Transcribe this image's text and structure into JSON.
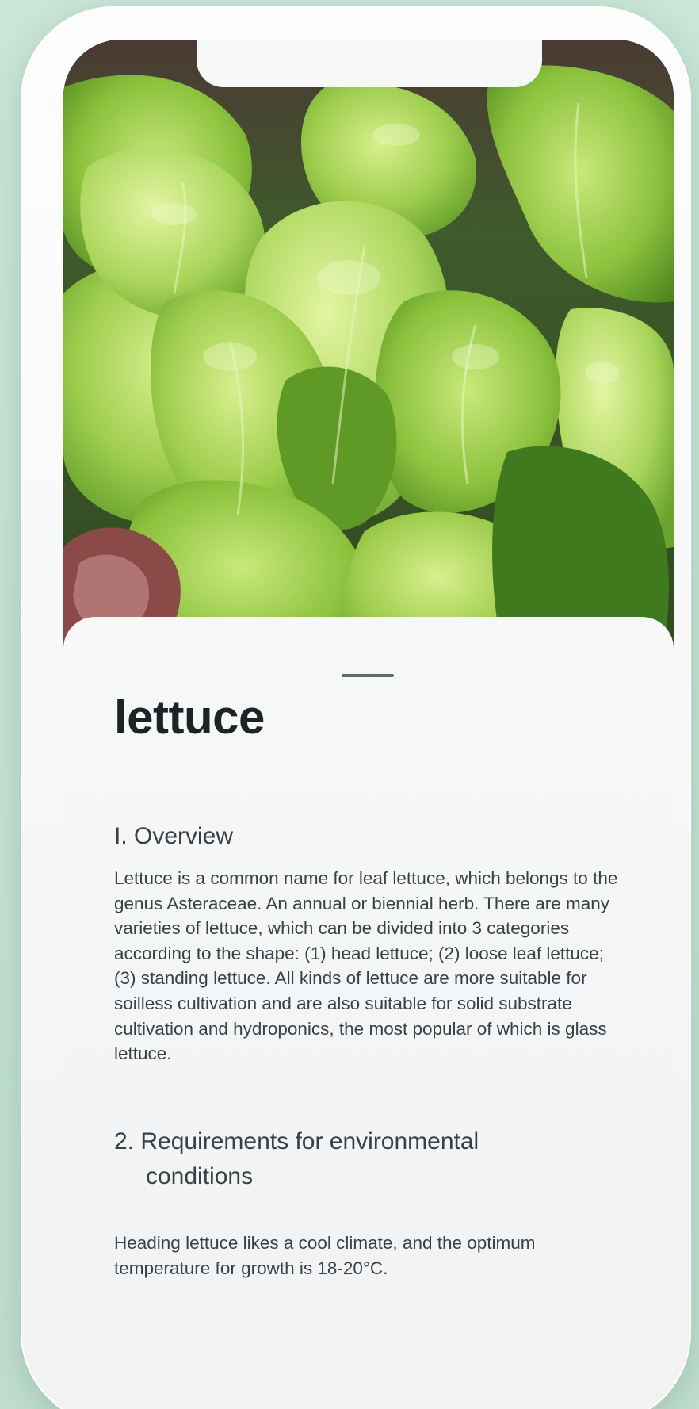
{
  "plant": {
    "title": "lettuce",
    "image_alt": "lettuce plant photo"
  },
  "sections": [
    {
      "heading": "I. Overview",
      "body": "Lettuce is a common name for leaf lettuce, which belongs to the genus Asteraceae. An annual or biennial herb. There are many varieties of lettuce, which can be divided into 3 categories according to the shape: (1) head lettuce; (2) loose leaf lettuce; (3) standing lettuce. All kinds of lettuce are more suitable for soilless cultivation and are also suitable for solid substrate cultivation and hydroponics, the most popular of which is glass lettuce."
    },
    {
      "heading_line1": "2. Requirements for environmental",
      "heading_line2": "conditions",
      "body": "Heading lettuce likes a cool climate, and the optimum temperature for growth is 18-20°C."
    }
  ],
  "colors": {
    "background": "#c6e3d3",
    "phone_frame": "#f8f9f9",
    "title_text": "#1f2326",
    "body_text": "#3b4045"
  }
}
